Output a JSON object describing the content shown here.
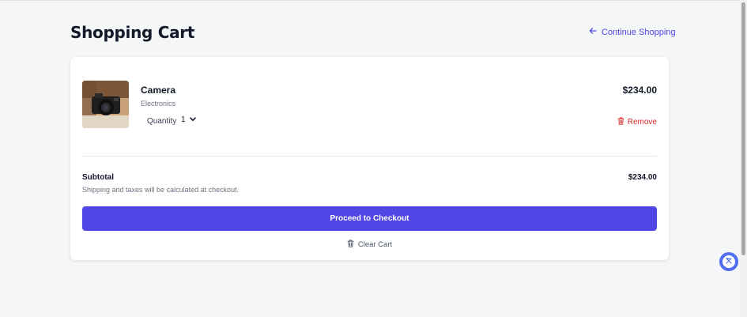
{
  "header": {
    "title": "Shopping Cart",
    "continue_label": "Continue Shopping",
    "continue_icon": "arrow-left-icon"
  },
  "cart": {
    "items": [
      {
        "name": "Camera",
        "category": "Electronics",
        "quantity_label": "Quantity",
        "quantity": "1",
        "price": "$234.00",
        "remove_label": "Remove",
        "image_icon": "camera-photo"
      }
    ],
    "subtotal_label": "Subtotal",
    "subtotal_value": "$234.00",
    "shipping_note": "Shipping and taxes will be calculated at checkout.",
    "checkout_label": "Proceed to Checkout",
    "clear_label": "Clear Cart"
  },
  "colors": {
    "accent": "#4f46e5",
    "danger": "#dc2626",
    "background": "#f5f6f8"
  }
}
